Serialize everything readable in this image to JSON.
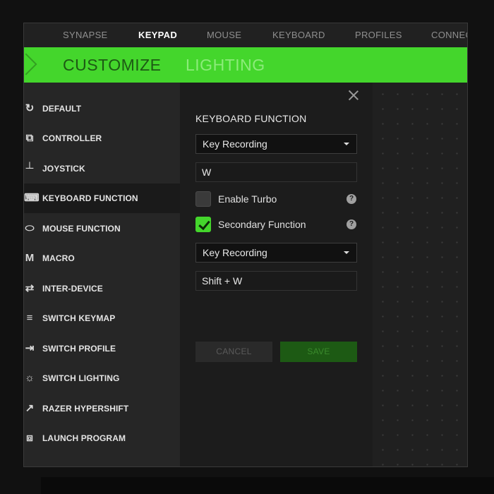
{
  "top_nav": {
    "tabs": [
      {
        "label": "SYNAPSE",
        "active": false
      },
      {
        "label": "KEYPAD",
        "active": true
      },
      {
        "label": "MOUSE",
        "active": false
      },
      {
        "label": "KEYBOARD",
        "active": false
      },
      {
        "label": "PROFILES",
        "active": false
      },
      {
        "label": "CONNEC",
        "active": false
      }
    ]
  },
  "sub_nav": {
    "tabs": [
      {
        "label": "CUSTOMIZE",
        "active": true
      },
      {
        "label": "LIGHTING",
        "active": false
      }
    ]
  },
  "sidebar": {
    "items": [
      {
        "label": "DEFAULT",
        "icon": "refresh-icon",
        "active": false
      },
      {
        "label": "CONTROLLER",
        "icon": "controller-icon",
        "active": false
      },
      {
        "label": "JOYSTICK",
        "icon": "joystick-icon",
        "active": false
      },
      {
        "label": "KEYBOARD FUNCTION",
        "icon": "keyboard-icon",
        "active": true
      },
      {
        "label": "MOUSE FUNCTION",
        "icon": "mouse-icon",
        "active": false
      },
      {
        "label": "MACRO",
        "icon": "macro-icon",
        "active": false
      },
      {
        "label": "INTER-DEVICE",
        "icon": "inter-device-icon",
        "active": false
      },
      {
        "label": "SWITCH KEYMAP",
        "icon": "keymap-icon",
        "active": false
      },
      {
        "label": "SWITCH PROFILE",
        "icon": "switch-profile-icon",
        "active": false
      },
      {
        "label": "SWITCH LIGHTING",
        "icon": "lighting-icon",
        "active": false
      },
      {
        "label": "RAZER HYPERSHIFT",
        "icon": "hypershift-icon",
        "active": false
      },
      {
        "label": "LAUNCH PROGRAM",
        "icon": "launch-program-icon",
        "active": false
      }
    ]
  },
  "panel": {
    "title": "KEYBOARD FUNCTION",
    "primary_mode": "Key Recording",
    "primary_key": "W",
    "enable_turbo": {
      "label": "Enable Turbo",
      "checked": false
    },
    "secondary_function": {
      "label": "Secondary Function",
      "checked": true
    },
    "secondary_mode": "Key Recording",
    "secondary_key": "Shift + W",
    "help_glyph": "?",
    "cancel_label": "CANCEL",
    "save_label": "SAVE"
  },
  "colors": {
    "accent": "#44d62c",
    "background": "#1f1f1f"
  }
}
